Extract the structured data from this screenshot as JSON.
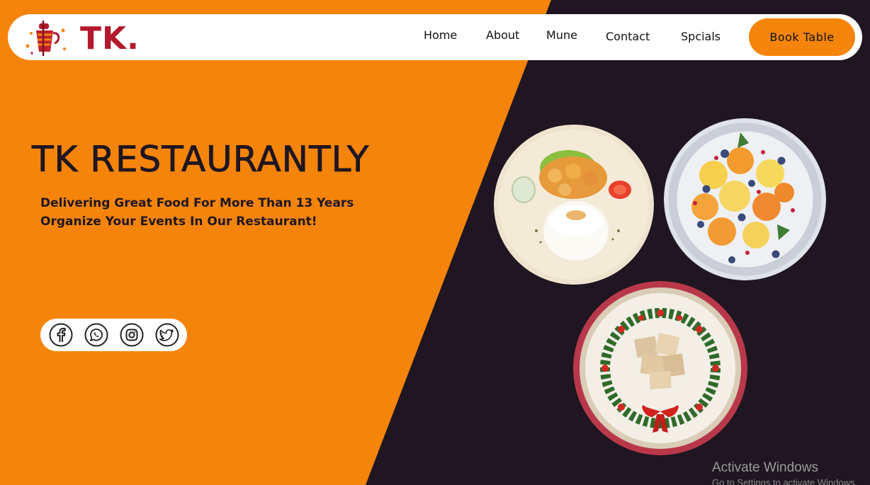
{
  "brand": {
    "logo_text": "TK."
  },
  "nav": {
    "items": [
      {
        "label": "Home"
      },
      {
        "label": "About"
      },
      {
        "label": "Mune"
      },
      {
        "label": "Contact"
      },
      {
        "label": "Spcials"
      }
    ],
    "cta_label": "Book  Table"
  },
  "hero": {
    "title": "TK RESTAURANTLY",
    "subtitle": "Delivering Great Food For More Than 13 Years Organize Your Events In Our Restaurant!"
  },
  "social": {
    "icons": [
      "facebook-icon",
      "whatsapp-icon",
      "instagram-icon",
      "twitter-icon"
    ]
  },
  "os_watermark": {
    "line1": "Activate Windows",
    "line2": "Go to Settings to activate Windows."
  },
  "colors": {
    "accent": "#f5840a",
    "dark": "#1f1621",
    "brand_red": "#b3182c"
  }
}
